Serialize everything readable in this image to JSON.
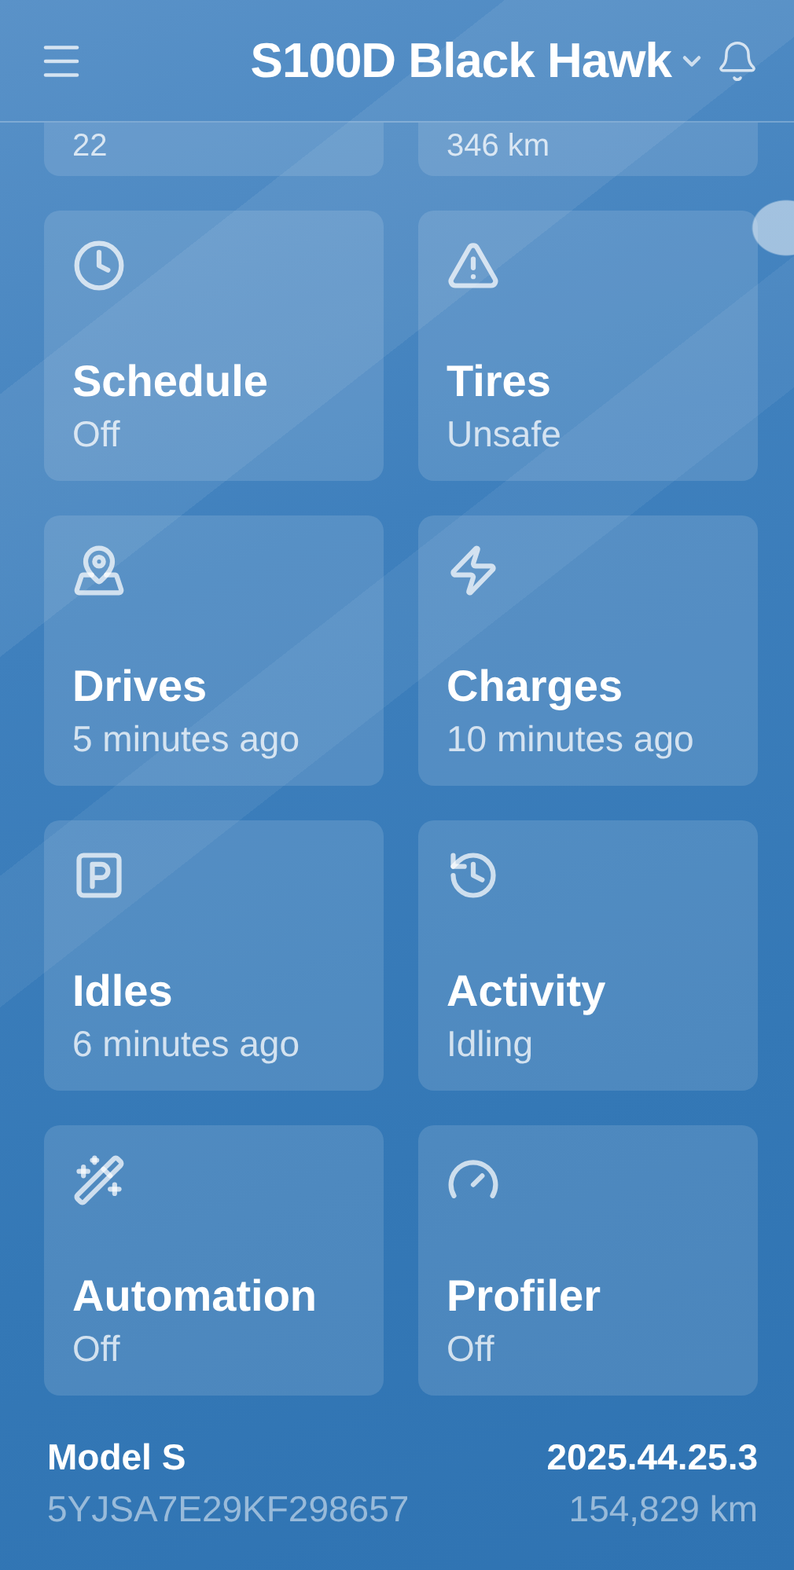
{
  "header": {
    "title": "S100D Black Hawk"
  },
  "partial_cards": [
    {
      "value": "22"
    },
    {
      "value": "346 km"
    }
  ],
  "cards": [
    {
      "title": "Schedule",
      "subtitle": "Off"
    },
    {
      "title": "Tires",
      "subtitle": "Unsafe"
    },
    {
      "title": "Drives",
      "subtitle": "5 minutes ago"
    },
    {
      "title": "Charges",
      "subtitle": "10 minutes ago"
    },
    {
      "title": "Idles",
      "subtitle": "6 minutes ago"
    },
    {
      "title": "Activity",
      "subtitle": "Idling"
    },
    {
      "title": "Automation",
      "subtitle": "Off"
    },
    {
      "title": "Profiler",
      "subtitle": "Off"
    }
  ],
  "footer": {
    "model": "Model S",
    "version": "2025.44.25.3",
    "vin": "5YJSA7E29KF298657",
    "odometer": "154,829 km"
  }
}
